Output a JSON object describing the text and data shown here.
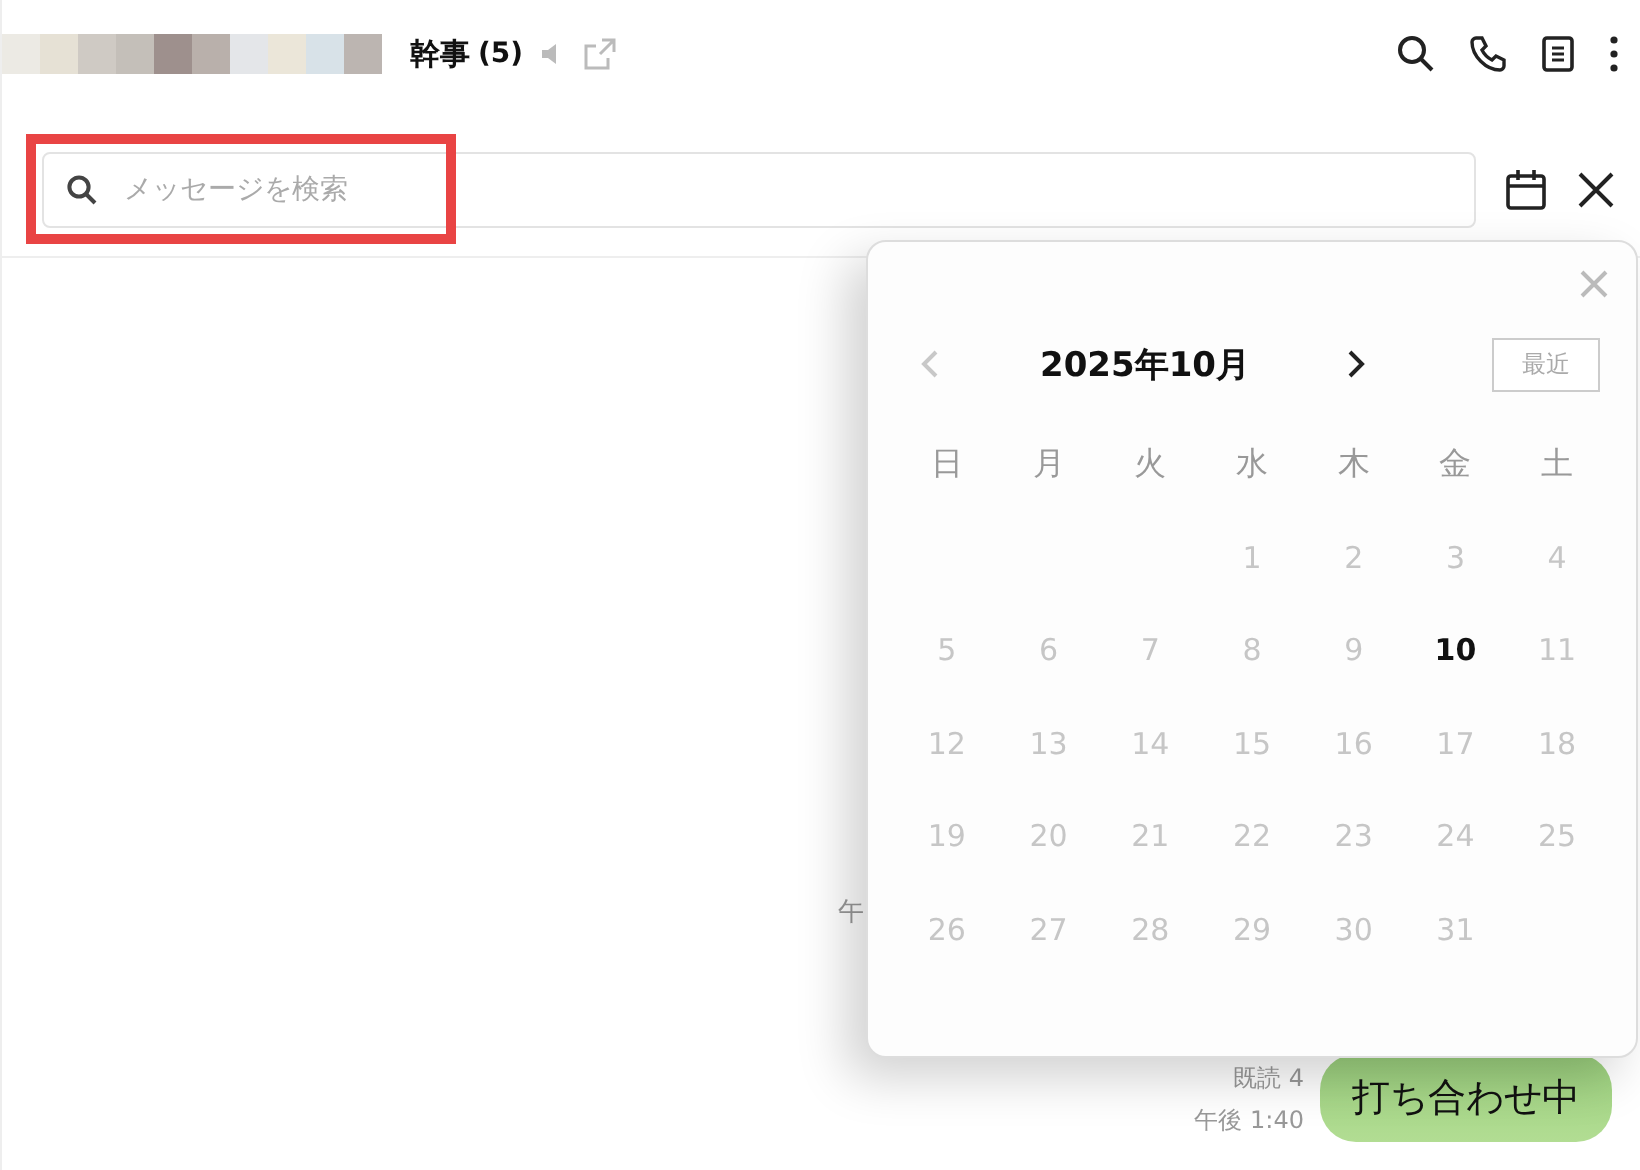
{
  "header": {
    "title": "幹事",
    "member_count": "(5)",
    "muted": true
  },
  "search": {
    "placeholder": "メッセージを検索",
    "highlighted": true
  },
  "calendar": {
    "month_label": "2025年10月",
    "prev_disabled": true,
    "recent_button": "最近",
    "weekdays": [
      "日",
      "月",
      "火",
      "水",
      "木",
      "金",
      "土"
    ],
    "weeks": [
      [
        {
          "day": "1",
          "today": false
        },
        {
          "day": "2",
          "today": false
        },
        {
          "day": "3",
          "today": false
        },
        {
          "day": "4",
          "today": false
        }
      ],
      [
        {
          "day": "5",
          "today": false
        },
        {
          "day": "6",
          "today": false
        },
        {
          "day": "7",
          "today": false
        },
        {
          "day": "8",
          "today": false
        },
        {
          "day": "9",
          "today": false
        },
        {
          "day": "10",
          "today": true
        },
        {
          "day": "11",
          "today": false
        }
      ],
      [
        {
          "day": "12",
          "today": false
        },
        {
          "day": "13",
          "today": false
        },
        {
          "day": "14",
          "today": false
        },
        {
          "day": "15",
          "today": false
        },
        {
          "day": "16",
          "today": false
        },
        {
          "day": "17",
          "today": false
        },
        {
          "day": "18",
          "today": false
        }
      ],
      [
        {
          "day": "19",
          "today": false
        },
        {
          "day": "20",
          "today": false
        },
        {
          "day": "21",
          "today": false
        },
        {
          "day": "22",
          "today": false
        },
        {
          "day": "23",
          "today": false
        },
        {
          "day": "24",
          "today": false
        },
        {
          "day": "25",
          "today": false
        }
      ],
      [
        {
          "day": "26",
          "today": false
        },
        {
          "day": "27",
          "today": false
        },
        {
          "day": "28",
          "today": false
        },
        {
          "day": "29",
          "today": false
        },
        {
          "day": "30",
          "today": false
        },
        {
          "day": "31",
          "today": false
        }
      ]
    ]
  },
  "messages": [
    {
      "kind": "fragment",
      "time": "午"
    },
    {
      "kind": "outgoing",
      "read": "既読 4",
      "time": "午後 1:40",
      "text": "打ち合わせ中"
    }
  ]
}
